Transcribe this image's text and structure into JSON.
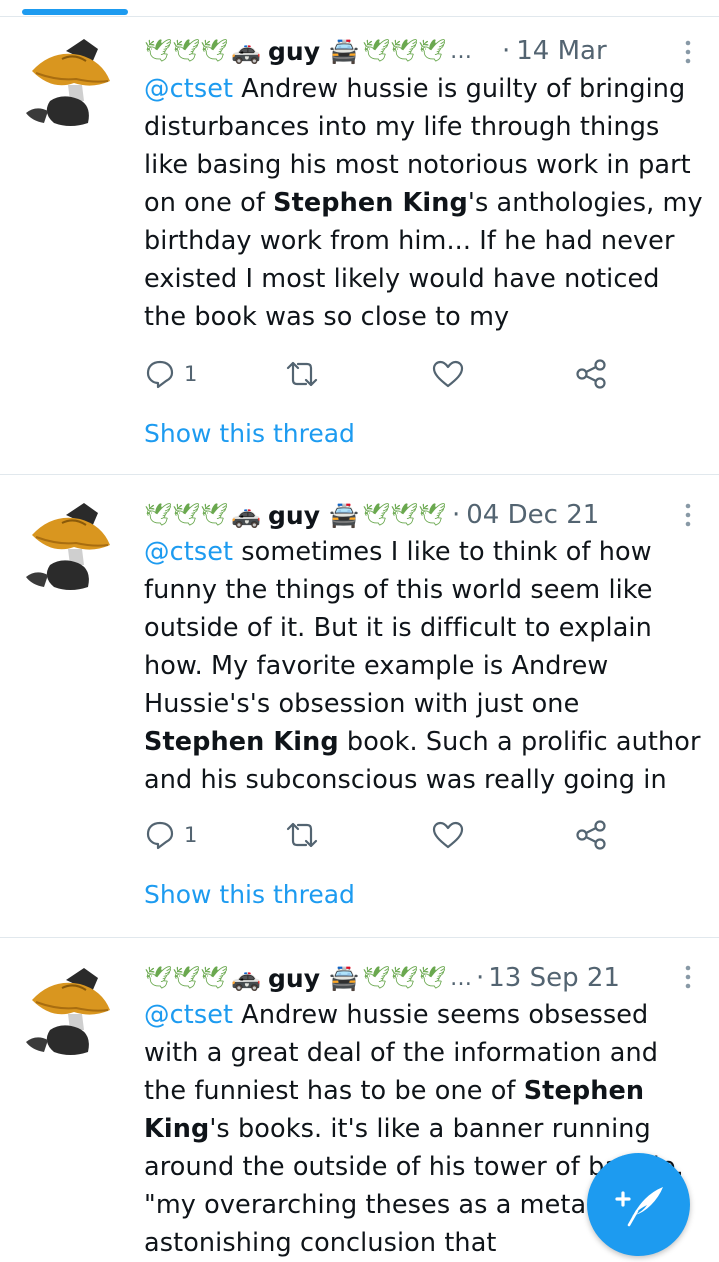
{
  "tab_indicator_color": "#1d9bf0",
  "accent_color": "#1d9bf0",
  "icons": {
    "avatar": "cartoon-duck-avatar",
    "reply": "reply-icon",
    "retweet": "retweet-icon",
    "like": "heart-icon",
    "share": "share-icon",
    "more": "more-vertical-icon",
    "compose": "compose-tweet-icon"
  },
  "tweets": [
    {
      "display_name": "guy",
      "date": "14 Mar",
      "mention": "@ctset",
      "text_1": " Andrew hussie is guilty of bringing disturbances into my life through things like basing his most notorious work in part on one of ",
      "bold_1": "Stephen King",
      "text_2": "'s anthologies, my birthday work from him... If he had never existed I most likely would have noticed the book was so close to my",
      "reply_count": "1",
      "thread_link": "Show this thread"
    },
    {
      "display_name": "guy",
      "date": "04 Dec 21",
      "mention": "@ctset",
      "text_1": " sometimes I like to think of how funny the things of this world seem like outside of it. But it is difficult to explain how. My favorite example is Andrew Hussie's's obsession with just one ",
      "bold_1": "Stephen King",
      "text_2": " book. Such a prolific author and his subconscious was really going in",
      "reply_count": "1",
      "thread_link": "Show this thread"
    },
    {
      "display_name": "guy",
      "date": "13 Sep 21",
      "mention": "@ctset",
      "text_1": " Andrew hussie seems obsessed with a great deal of the information and the funniest has to be one of ",
      "bold_1": "Stephen King",
      "text_2": "'s books. it's like a banner running around the outside of his tower of babble. \"my overarching theses as a meta writer astonishing conclusion that",
      "reply_count": "",
      "thread_link": ""
    }
  ]
}
